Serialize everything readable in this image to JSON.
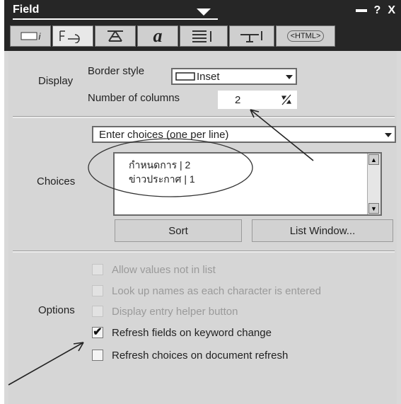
{
  "title": "Field",
  "title_buttons": {
    "help": "?",
    "close": "X"
  },
  "tabs": [
    {
      "label": "i",
      "icon": "field-info-icon"
    },
    {
      "label": "",
      "icon": "field-control-icon"
    },
    {
      "label": "",
      "icon": "alignment-icon"
    },
    {
      "label": "a",
      "icon": "font-icon"
    },
    {
      "label": "",
      "icon": "paragraph-icon"
    },
    {
      "label": "",
      "icon": "hide-when-icon"
    },
    {
      "label": "<HTML>",
      "icon": "html-icon"
    }
  ],
  "display": {
    "section_label": "Display",
    "border_style_label": "Border style",
    "border_style_value": "Inset",
    "columns_label": "Number of columns",
    "columns_value": "2"
  },
  "choices": {
    "section_label": "Choices",
    "method_value": "Enter choices (one per line)",
    "lines": [
      "กำหนดการ | 2",
      "ข่าวประกาศ | 1"
    ],
    "sort_button": "Sort",
    "list_window_button": "List Window..."
  },
  "options": {
    "section_label": "Options",
    "items": [
      {
        "label": "Allow values not in list",
        "checked": false,
        "enabled": false
      },
      {
        "label": "Look up names as each character is entered",
        "checked": false,
        "enabled": false
      },
      {
        "label": "Display entry helper button",
        "checked": false,
        "enabled": false
      },
      {
        "label": "Refresh fields on keyword change",
        "checked": true,
        "enabled": true
      },
      {
        "label": "Refresh choices on document refresh",
        "checked": false,
        "enabled": true
      }
    ]
  },
  "colors": {
    "titlebar": "#262626",
    "panel": "#d6d6d6",
    "field_bg": "#ffffff"
  }
}
